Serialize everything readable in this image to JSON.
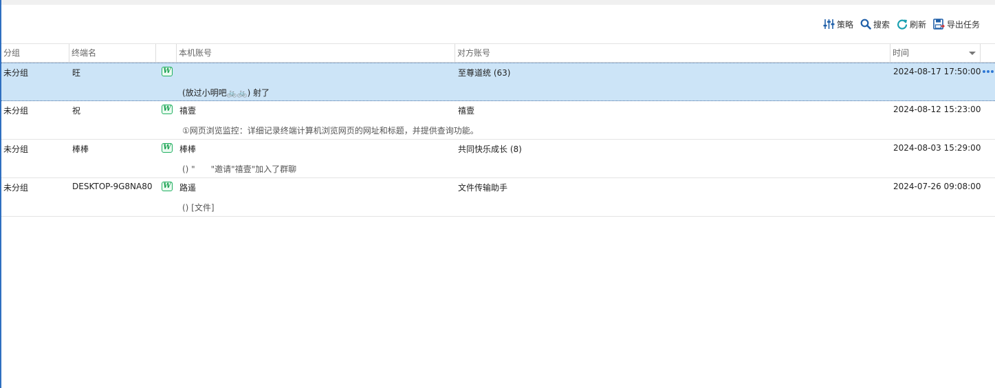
{
  "toolbar": {
    "strategy_label": "策略",
    "search_label": "搜索",
    "refresh_label": "刷新",
    "export_label": "导出任务"
  },
  "columns": {
    "group": "分组",
    "terminal": "终端名",
    "local_account": "本机账号",
    "peer_account": "对方账号",
    "time": "时间"
  },
  "rows": [
    {
      "group": "未分组",
      "terminal": "旺",
      "app_icon": "wechat-work-icon",
      "local_account": "",
      "peer_account": "至尊道统 (63)",
      "time": "2024-08-17 17:50:00",
      "message": "(放过小明吧🚲🚲) 射了"
    },
    {
      "group": "未分组",
      "terminal": "祝",
      "app_icon": "wechat-work-icon",
      "local_account": "禧壹",
      "peer_account": "禧壹",
      "time": "2024-08-12 15:23:00",
      "message": "①网页浏览监控：详细记录终端计算机浏览网页的网址和标题，并提供查询功能。"
    },
    {
      "group": "未分组",
      "terminal": "棒棒",
      "app_icon": "wechat-work-icon",
      "local_account": "棒棒",
      "peer_account": "共同快乐成长 (8)",
      "time": "2024-08-03 15:29:00",
      "message": "() \"      \"邀请\"禧壹\"加入了群聊"
    },
    {
      "group": "未分组",
      "terminal": "DESKTOP-9G8NA80",
      "app_icon": "wechat-work-icon",
      "local_account": "路遥",
      "peer_account": "文件传输助手",
      "time": "2024-07-26 09:08:00",
      "message": "() [文件]"
    }
  ],
  "colors": {
    "selected_row": "#cce4f7",
    "accent": "#2f78d4",
    "app_icon_green": "#18a04f"
  }
}
